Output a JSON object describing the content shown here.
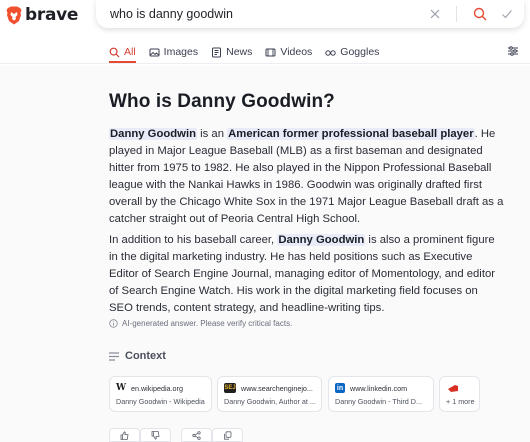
{
  "header": {
    "logo_text": "brave",
    "search_query": "who is danny goodwin"
  },
  "tabs": [
    {
      "label": "All",
      "icon": "search-icon",
      "active": true
    },
    {
      "label": "Images",
      "icon": "image-icon",
      "active": false
    },
    {
      "label": "News",
      "icon": "news-icon",
      "active": false
    },
    {
      "label": "Videos",
      "icon": "video-icon",
      "active": false
    },
    {
      "label": "Goggles",
      "icon": "goggles-icon",
      "active": false
    }
  ],
  "answer": {
    "title": "Who is Danny Goodwin?",
    "p1": {
      "hl1": "Danny Goodwin",
      "t1": " is an ",
      "hl2": "American former professional baseball player",
      "t2": ". He played in Major League Baseball (MLB) as a first baseman and designated hitter from 1975 to 1982. He also played in the Nippon Professional Baseball league with the Nankai Hawks in 1986. Goodwin was originally drafted first overall by the Chicago White Sox in the 1971 Major League Baseball draft as a catcher straight out of Peoria Central High School."
    },
    "p2": {
      "t1": "In addition to his baseball career, ",
      "hl1": "Danny Goodwin",
      "t2": " is also a prominent figure in the digital marketing industry. He has held positions such as Executive Editor of Search Engine Journal, managing editor of Momentology, and editor of Search Engine Watch. His work in the digital marketing field focuses on SEO trends, content strategy, and headline-writing tips."
    },
    "disclaimer": "AI-generated answer. Please verify critical facts."
  },
  "context": {
    "heading": "Context",
    "cards": [
      {
        "source": "en.wikipedia.org",
        "subtitle": "Danny Goodwin - Wikipedia",
        "favicon": "wikipedia-icon"
      },
      {
        "source": "www.searchenginejo...",
        "subtitle": "Danny Goodwin, Author at ...",
        "favicon": "sej-icon"
      },
      {
        "source": "www.linkedin.com",
        "subtitle": "Danny Goodwin - Third D...",
        "favicon": "linkedin-icon"
      },
      {
        "source": "",
        "subtitle": "+ 1 more",
        "favicon": "more-icon"
      }
    ]
  },
  "colors": {
    "accent": "#e64a32",
    "highlight_bg": "#e9ecf8",
    "page_bg": "#fafafb"
  }
}
